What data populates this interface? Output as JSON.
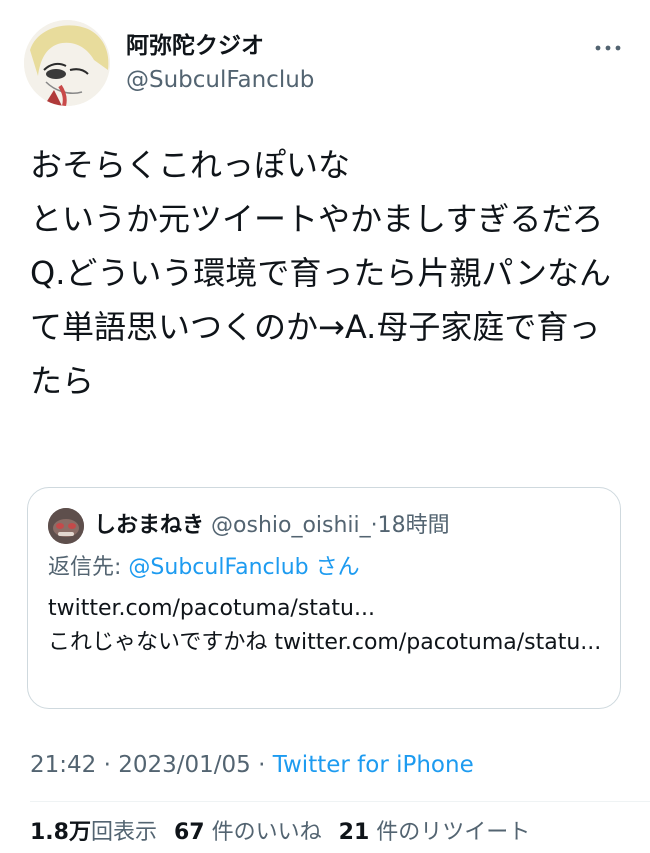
{
  "author": {
    "display_name": "阿弥陀クジオ",
    "handle": "@SubculFanclub"
  },
  "tweet": {
    "text": "おそらくこれっぽいな\nというか元ツイートやかましすぎるだろ\nQ.どういう環境で育ったら片親パンなんて単語思いつくのか→A.母子家庭で育ったら"
  },
  "quote": {
    "author_name": "しおまねき",
    "author_handle": "@oshio_oishii_",
    "separator": "·",
    "time_ago": "18時間",
    "reply_prefix": "返信先:",
    "reply_mention": "@SubculFanclub",
    "reply_suffix": "さん",
    "body": "twitter.com/pacotuma/statu...\nこれじゃないですかね twitter.com/pacotuma/statu..."
  },
  "meta": {
    "time": "21:42",
    "separator": "·",
    "date": "2023/01/05",
    "source": "Twitter for iPhone"
  },
  "stats": {
    "views_num": "1.8万",
    "views_label": "回表示",
    "likes_num": "67",
    "likes_label": "件のいいね",
    "retweets_num": "21",
    "retweets_label": "件のリツイート"
  },
  "icons": {
    "more": "more-horizontal-icon"
  },
  "colors": {
    "text": "#0f1419",
    "secondary": "#536471",
    "link": "#1d9bf0",
    "border": "#cfd9de"
  }
}
